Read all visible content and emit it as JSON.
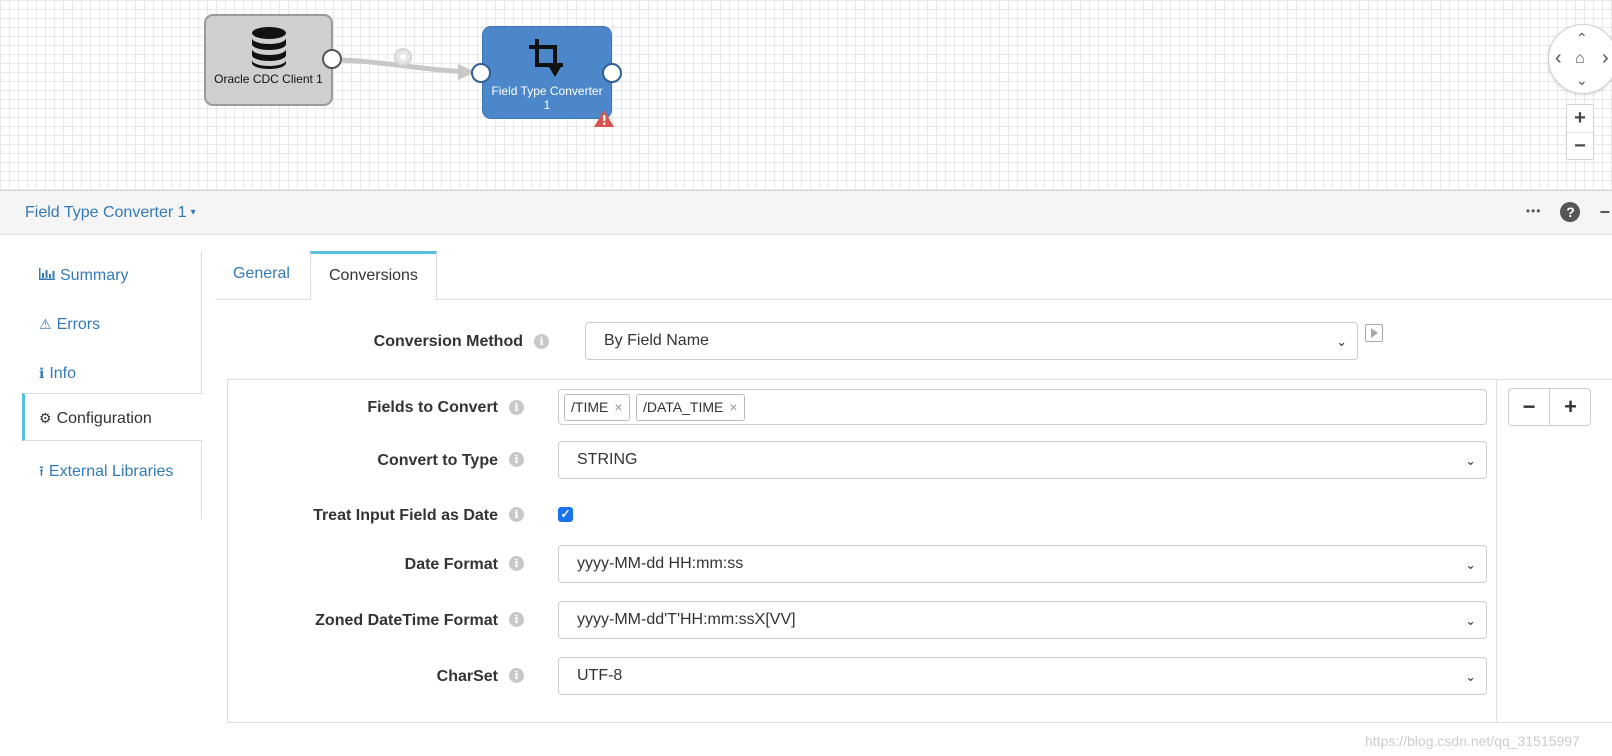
{
  "pipeline": {
    "stages": [
      {
        "label": "Oracle CDC Client 1",
        "icon": "database-icon"
      },
      {
        "label": "Field Type Converter 1",
        "icon": "crop-convert-icon"
      }
    ],
    "link_icon": "stream-gear-icon",
    "warning_icon": "warning-triangle-icon"
  },
  "canvas_controls": {
    "pan": {
      "up": "⌃",
      "down": "⌄",
      "left": "‹",
      "right": "›",
      "home": "⌂"
    },
    "zoom_in": "+",
    "zoom_out": "−"
  },
  "detail": {
    "stage_name": "Field Type Converter 1",
    "caret": "▾",
    "actions": {
      "more": "•••",
      "help": "?",
      "collapse": "−"
    }
  },
  "side_nav": [
    {
      "label": "Summary",
      "icon": "bar-chart-icon",
      "glyph": "📊"
    },
    {
      "label": "Errors",
      "icon": "warning-icon",
      "glyph": "⚠"
    },
    {
      "label": "Info",
      "icon": "info-icon",
      "glyph": "ℹ"
    },
    {
      "label": "Configuration",
      "icon": "gear-icon",
      "glyph": "⚙",
      "active": true
    },
    {
      "label": "External Libraries",
      "icon": "upload-icon",
      "glyph": "⭱"
    }
  ],
  "tabs": [
    {
      "label": "General",
      "active": false
    },
    {
      "label": "Conversions",
      "active": true
    }
  ],
  "form": {
    "conversion_method": {
      "label": "Conversion Method",
      "value": "By Field Name"
    },
    "fields_to_convert": {
      "label": "Fields to Convert",
      "tags": [
        "/TIME",
        "/DATA_TIME"
      ],
      "remove_glyph": "×"
    },
    "convert_to_type": {
      "label": "Convert to Type",
      "value": "STRING"
    },
    "treat_as_date": {
      "label": "Treat Input Field as Date",
      "checked": true,
      "check_glyph": "✓"
    },
    "date_format": {
      "label": "Date Format",
      "value": "yyyy-MM-dd HH:mm:ss"
    },
    "zoned_datetime_format": {
      "label": "Zoned DateTime Format",
      "value": "yyyy-MM-dd'T'HH:mm:ssX[VV]"
    },
    "charset": {
      "label": "CharSet",
      "value": "UTF-8"
    },
    "info_glyph": "i",
    "chevron": "⌄",
    "list_buttons": {
      "remove": "−",
      "add": "+"
    }
  },
  "watermark": "https://blog.csdn.net/qq_31515997",
  "colors": {
    "accent": "#337ab7",
    "stage_blue": "#4c88c9",
    "tab_highlight": "#5bc0de",
    "checkbox": "#1a73e8",
    "warning": "#d9534f"
  }
}
